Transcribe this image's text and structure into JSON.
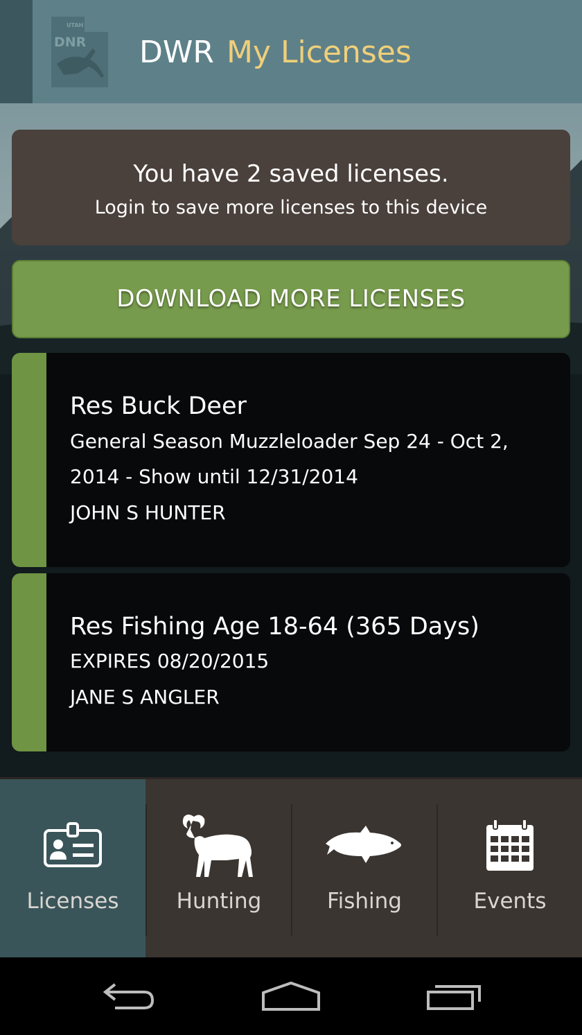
{
  "header": {
    "brand_text": "DWR",
    "app_title": "My Licenses",
    "logo_text_top": "UTAH",
    "logo_text_main": "DNR",
    "colors": {
      "header_bg": "#5e8189",
      "title_accent": "#f0cf7a"
    }
  },
  "notice": {
    "headline": "You have 2 saved licenses.",
    "subline": "Login to save more licenses to this device"
  },
  "download_button": {
    "label": "DOWNLOAD MORE LICENSES",
    "color": "#779b4c"
  },
  "licenses": [
    {
      "name": "Res Buck Deer",
      "description": "General Season Muzzleloader Sep 24 - Oct 2, 2014 - Show until 12/31/2014",
      "holder": "JOHN S HUNTER"
    },
    {
      "name": "Res Fishing Age 18-64 (365 Days)",
      "description": "EXPIRES 08/20/2015",
      "holder": "JANE S ANGLER"
    }
  ],
  "tabs": [
    {
      "label": "Licenses",
      "icon": "id-card-icon",
      "active": true
    },
    {
      "label": "Hunting",
      "icon": "bighorn-sheep-icon",
      "active": false
    },
    {
      "label": "Fishing",
      "icon": "trout-icon",
      "active": false
    },
    {
      "label": "Events",
      "icon": "calendar-icon",
      "active": false
    }
  ],
  "system_nav": {
    "icons": [
      "back-icon",
      "home-icon",
      "recent-apps-icon"
    ]
  }
}
